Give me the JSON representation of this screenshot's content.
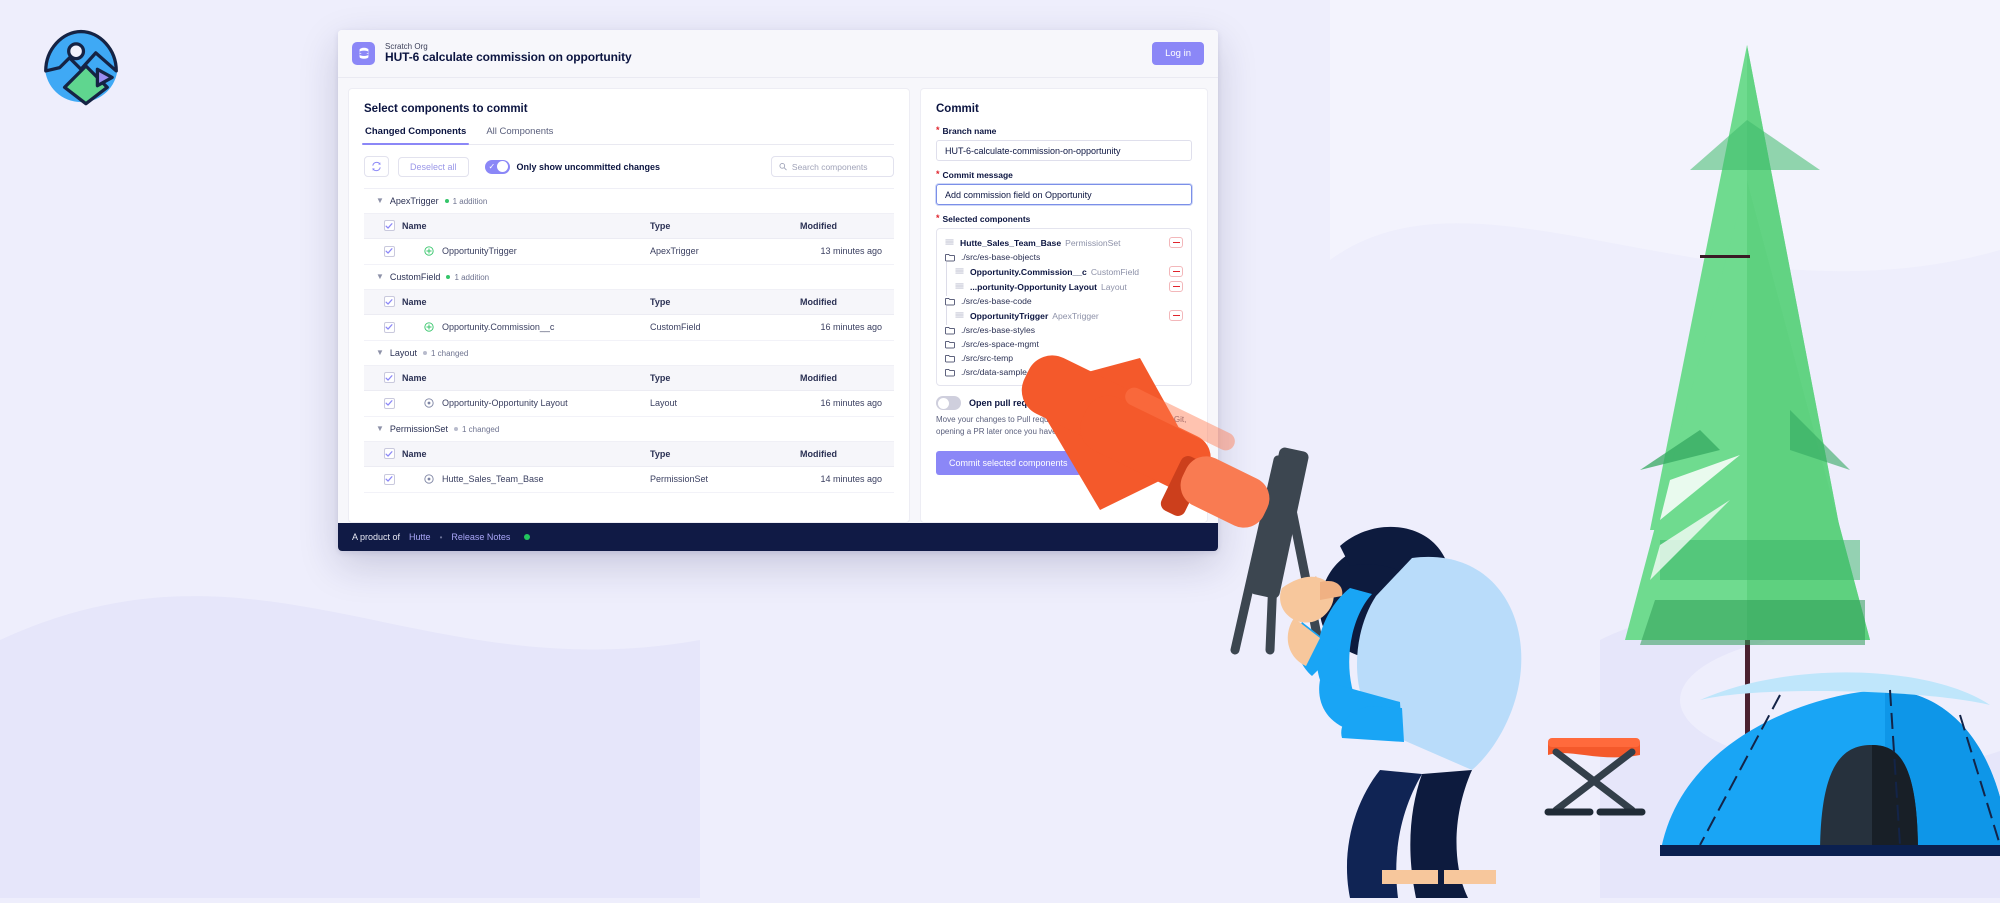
{
  "brand": {
    "logo_icon": "image-play-logo"
  },
  "window": {
    "org_label": "Scratch Org",
    "org_title": "HUT-6 calculate commission on opportunity",
    "org_icon": "database-icon",
    "login_label": "Log in"
  },
  "left_panel": {
    "title": "Select components to commit",
    "tabs": [
      {
        "label": "Changed Components",
        "active": true
      },
      {
        "label": "All Components",
        "active": false
      }
    ],
    "toolbar": {
      "refresh_icon": "refresh-icon",
      "deselect_label": "Deselect all",
      "toggle_on": true,
      "toggle_label": "Only show uncommitted changes",
      "search_placeholder": "Search components",
      "search_value": "",
      "search_icon": "search-icon"
    },
    "columns": {
      "name": "Name",
      "type": "Type",
      "modified": "Modified"
    },
    "groups": [
      {
        "name": "ApexTrigger",
        "count_label": "1 addition",
        "count_kind": "add",
        "expanded": true,
        "rows": [
          {
            "checked": true,
            "icon": "plus-circle-icon",
            "icon_kind": "add",
            "name": "OpportunityTrigger",
            "type": "ApexTrigger",
            "modified": "13 minutes ago"
          }
        ]
      },
      {
        "name": "CustomField",
        "count_label": "1 addition",
        "count_kind": "add",
        "expanded": true,
        "rows": [
          {
            "checked": true,
            "icon": "plus-circle-icon",
            "icon_kind": "add",
            "name": "Opportunity.Commission__c",
            "type": "CustomField",
            "modified": "16 minutes ago"
          }
        ]
      },
      {
        "name": "Layout",
        "count_label": "1 changed",
        "count_kind": "chg",
        "expanded": true,
        "rows": [
          {
            "checked": true,
            "icon": "dot-circle-icon",
            "icon_kind": "chg",
            "name": "Opportunity-Opportunity Layout",
            "type": "Layout",
            "modified": "16 minutes ago"
          }
        ]
      },
      {
        "name": "PermissionSet",
        "count_label": "1 changed",
        "count_kind": "chg",
        "expanded": true,
        "rows": [
          {
            "checked": true,
            "icon": "dot-circle-icon",
            "icon_kind": "chg",
            "name": "Hutte_Sales_Team_Base",
            "type": "PermissionSet",
            "modified": "14 minutes ago"
          }
        ]
      }
    ]
  },
  "right_panel": {
    "title": "Commit",
    "branch": {
      "label": "Branch name",
      "required": true,
      "value": "HUT-6-calculate-commission-on-opportunity",
      "placeholder": "Branch name"
    },
    "message": {
      "label": "Commit message",
      "required": true,
      "value": "Add commission field on Opportunity",
      "placeholder": "Commit message",
      "focused": true
    },
    "selected": {
      "label": "Selected components",
      "required": true,
      "entries": [
        {
          "kind": "component",
          "indent": 0,
          "name": "Hutte_Sales_Team_Base",
          "type": "PermissionSet",
          "remove_icon": "minus-icon"
        },
        {
          "kind": "folder",
          "indent": 0,
          "name": "./src/es-base-objects",
          "icon": "folder-icon"
        },
        {
          "kind": "component",
          "indent": 1,
          "name": "Opportunity.Commission__c",
          "type": "CustomField",
          "remove_icon": "minus-icon"
        },
        {
          "kind": "component",
          "indent": 1,
          "name": "...portunity-Opportunity Layout",
          "type": "Layout",
          "remove_icon": "minus-icon"
        },
        {
          "kind": "folder",
          "indent": 0,
          "name": "./src/es-base-code",
          "icon": "folder-icon"
        },
        {
          "kind": "component",
          "indent": 1,
          "name": "OpportunityTrigger",
          "type": "ApexTrigger",
          "remove_icon": "minus-icon"
        },
        {
          "kind": "folder",
          "indent": 0,
          "name": "./src/es-base-styles",
          "icon": "folder-icon"
        },
        {
          "kind": "folder",
          "indent": 0,
          "name": "./src/es-space-mgmt",
          "icon": "folder-icon"
        },
        {
          "kind": "folder",
          "indent": 0,
          "name": "./src/src-temp",
          "icon": "folder-icon"
        },
        {
          "kind": "folder",
          "indent": 0,
          "name": "./src/data-sample-",
          "icon": "folder-icon"
        }
      ]
    },
    "pull_request": {
      "toggle_on": false,
      "label": "Open pull request",
      "description": "Move your changes to Pull request - or skip this and just commit to Git, opening a PR later once you have finished your work on this feature."
    },
    "commit_button": "Commit selected components"
  },
  "footer": {
    "prefix": "A product of",
    "brand": "Hutte",
    "separator": "•",
    "release_notes": "Release Notes",
    "status_color": "#22c55e"
  },
  "colors": {
    "accent": "#8b87f7",
    "dark_navy": "#101a45",
    "added": "#35c56a",
    "required": "#e0242c",
    "background": "#eeeefc"
  }
}
